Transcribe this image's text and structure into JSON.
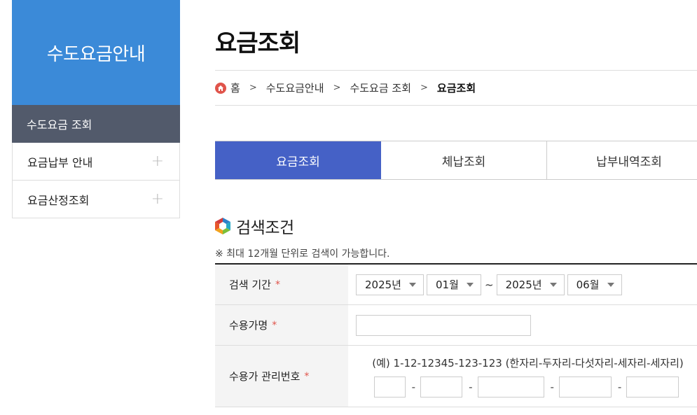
{
  "sidebar": {
    "title": "수도요금안내",
    "active_item": "수도요금 조회",
    "items": [
      {
        "label": "요금납부 안내",
        "plus": "+"
      },
      {
        "label": "요금산정조회",
        "plus": "+"
      }
    ]
  },
  "page": {
    "title": "요금조회"
  },
  "breadcrumb": {
    "home": "홈",
    "separator": ">",
    "items": [
      "수도요금안내",
      "수도요금 조회"
    ],
    "current": "요금조회"
  },
  "tabs": [
    {
      "label": "요금조회",
      "active": true
    },
    {
      "label": "체납조회",
      "active": false
    },
    {
      "label": "납부내역조회",
      "active": false
    }
  ],
  "section": {
    "title": "검색조건",
    "note": "※ 최대 12개월 단위로 검색이 가능합니다."
  },
  "form": {
    "required_mark": "*",
    "period": {
      "label": "검색 기간",
      "start_year": "2025년",
      "start_month": "01월",
      "tilde": "~",
      "end_year": "2025년",
      "end_month": "06월"
    },
    "customer_name": {
      "label": "수용가명",
      "value": ""
    },
    "mgmt_number": {
      "label": "수용가 관리번호",
      "example": "(예) 1-12-12345-123-123 (한자리-두자리-다섯자리-세자리-세자리)",
      "dash": "-",
      "parts": [
        "",
        "",
        "",
        "",
        ""
      ]
    }
  },
  "colors": {
    "sidebar_header": "#3b8ad8",
    "sidebar_active": "#525a6b",
    "tab_active": "#4561c6",
    "required": "#e0544b",
    "home_icon": "#e0544b"
  }
}
